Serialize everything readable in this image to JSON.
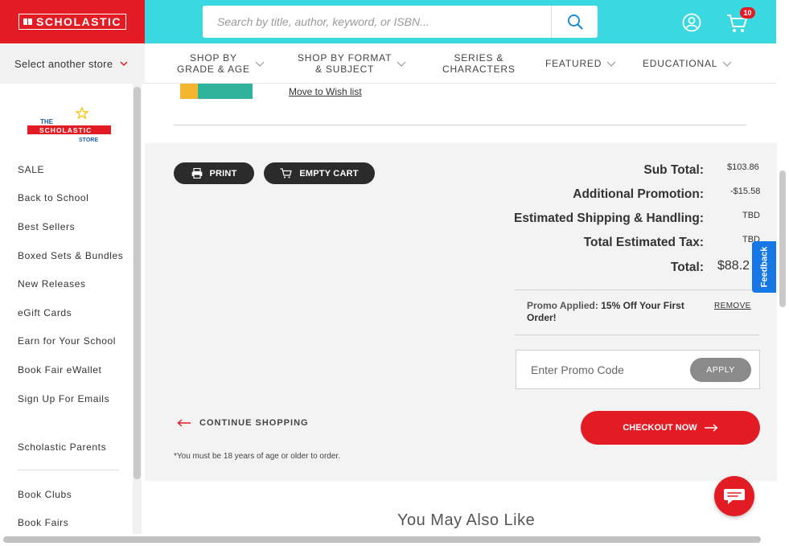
{
  "header": {
    "logo_text": "SCHOLASTIC",
    "search_placeholder": "Search by title, author, keyword, or ISBN...",
    "cart_count": "10",
    "colors": {
      "brand_red": "#e31b23",
      "header_cyan": "#3ad8e1"
    }
  },
  "nav": {
    "store_select": "Select another store",
    "items": [
      {
        "line1": "SHOP BY",
        "line2": "GRADE & AGE"
      },
      {
        "line1": "SHOP BY FORMAT",
        "line2": "& SUBJECT"
      },
      {
        "line1": "SERIES &",
        "line2": "CHARACTERS"
      },
      {
        "line1": "FEATURED",
        "line2": ""
      },
      {
        "line1": "EDUCATIONAL",
        "line2": ""
      }
    ]
  },
  "sidebar": {
    "store_logo": {
      "line1": "THE",
      "line2": "SCHOLASTIC",
      "line3": "STORE"
    },
    "items": [
      "SALE",
      "Back to School",
      "Best Sellers",
      "Boxed Sets & Bundles",
      "New Releases",
      "eGift Cards",
      "Earn for Your School",
      "Book Fair eWallet",
      "Sign Up For Emails",
      "Scholastic Parents",
      "Book Clubs",
      "Book Fairs"
    ]
  },
  "cart_item": {
    "wishlist_link": "Move to Wish list"
  },
  "summary": {
    "print_label": "PRINT",
    "empty_cart_label": "EMPTY CART",
    "rows": [
      {
        "label": "Sub Total:",
        "value": "$103.86"
      },
      {
        "label": "Additional Promotion:",
        "value": "-$15.58"
      },
      {
        "label": "Estimated Shipping & Handling:",
        "value": "TBD"
      },
      {
        "label": "Total Estimated Tax:",
        "value": "TBD"
      },
      {
        "label": "Total:",
        "value": "$88.2"
      }
    ],
    "promo_applied_key": "Promo Applied:",
    "promo_applied_value": "15% Off Your First Order!",
    "remove_label": "REMOVE",
    "promo_placeholder": "Enter Promo Code",
    "apply_label": "APPLY",
    "continue_label": "CONTINUE SHOPPING",
    "checkout_label": "CHECKOUT NOW",
    "age_note": "*You must be 18 years of age or older to order."
  },
  "feedback_label": "Feedback",
  "also_like_title": "You May Also Like"
}
